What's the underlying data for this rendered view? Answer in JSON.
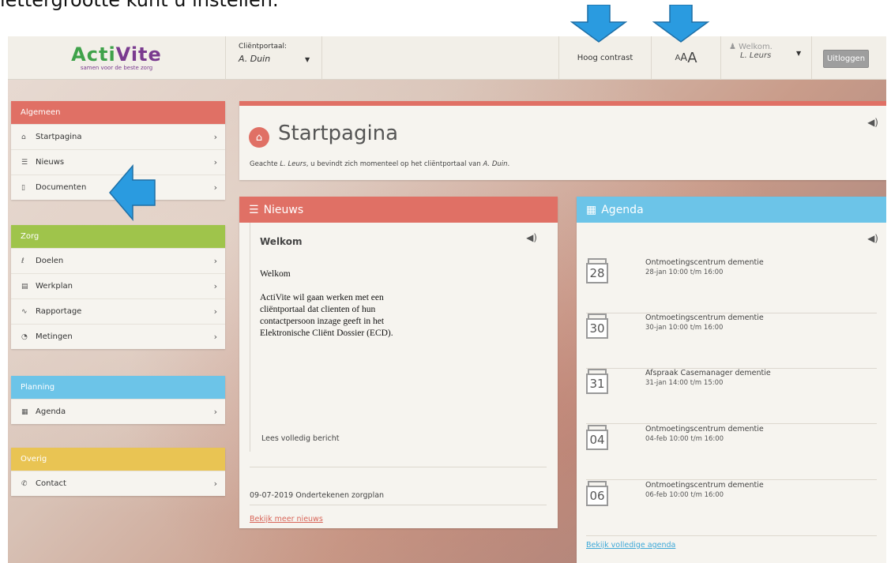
{
  "caption": "lettergrootte kunt u instellen.",
  "colors": {
    "red": "#e07065",
    "green": "#9fc44b",
    "blue": "#6cc4e8",
    "yellow": "#e9c453",
    "arrow": "#2a9be0"
  },
  "topbar": {
    "logo_main_a": "Acti",
    "logo_main_b": "Vite",
    "logo_sub": "samen voor de beste zorg",
    "portal_label": "Cliëntportaal:",
    "portal_name": "A. Duin",
    "high_contrast": "Hoog contrast",
    "font_small": "A",
    "font_medium": "A",
    "font_large": "A",
    "welcome_label": "Welkom.",
    "welcome_name": "L. Leurs",
    "logout": "Uitloggen"
  },
  "sidebar": {
    "algemeen": {
      "title": "Algemeen",
      "items": [
        {
          "icon": "home-icon",
          "label": "Startpagina"
        },
        {
          "icon": "list-icon",
          "label": "Nieuws"
        },
        {
          "icon": "document-icon",
          "label": "Documenten"
        }
      ]
    },
    "zorg": {
      "title": "Zorg",
      "items": [
        {
          "icon": "goal-icon",
          "label": "Doelen"
        },
        {
          "icon": "clipboard-icon",
          "label": "Werkplan"
        },
        {
          "icon": "pulse-icon",
          "label": "Rapportage"
        },
        {
          "icon": "gauge-icon",
          "label": "Metingen"
        }
      ]
    },
    "planning": {
      "title": "Planning",
      "items": [
        {
          "icon": "calendar-icon",
          "label": "Agenda"
        }
      ]
    },
    "overig": {
      "title": "Overig",
      "items": [
        {
          "icon": "phone-icon",
          "label": "Contact"
        }
      ]
    }
  },
  "start": {
    "title": "Startpagina",
    "sub_a": "Geachte ",
    "sub_name": "L. Leurs",
    "sub_b": ", u bevindt zich momenteel op het cliëntportaal van ",
    "sub_client": "A. Duin",
    "sub_c": "."
  },
  "news": {
    "header": "Nieuws",
    "title": "Welkom",
    "text_1": "Welkom",
    "text_2": "ActiVite wil gaan werken met een cliëntportaal dat clienten of hun contactpersoon inzage geeft in het Elektronische Cliënt Dossier (ECD).",
    "read_more": "Lees volledig bericht",
    "item_2": "09-07-2019 Ondertekenen zorgplan",
    "more_link": "Bekijk meer nieuws"
  },
  "agenda": {
    "header": "Agenda",
    "items": [
      {
        "day": "28",
        "title": "Ontmoetingscentrum dementie",
        "time": "28-jan 10:00 t/m 16:00"
      },
      {
        "day": "30",
        "title": "Ontmoetingscentrum dementie",
        "time": "30-jan 10:00 t/m 16:00"
      },
      {
        "day": "31",
        "title": "Afspraak Casemanager dementie",
        "time": "31-jan 14:00 t/m 15:00"
      },
      {
        "day": "04",
        "title": "Ontmoetingscentrum dementie",
        "time": "04-feb 10:00 t/m 16:00"
      },
      {
        "day": "06",
        "title": "Ontmoetingscentrum dementie",
        "time": "06-feb 10:00 t/m 16:00"
      }
    ],
    "full_link": "Bekijk volledige agenda"
  }
}
